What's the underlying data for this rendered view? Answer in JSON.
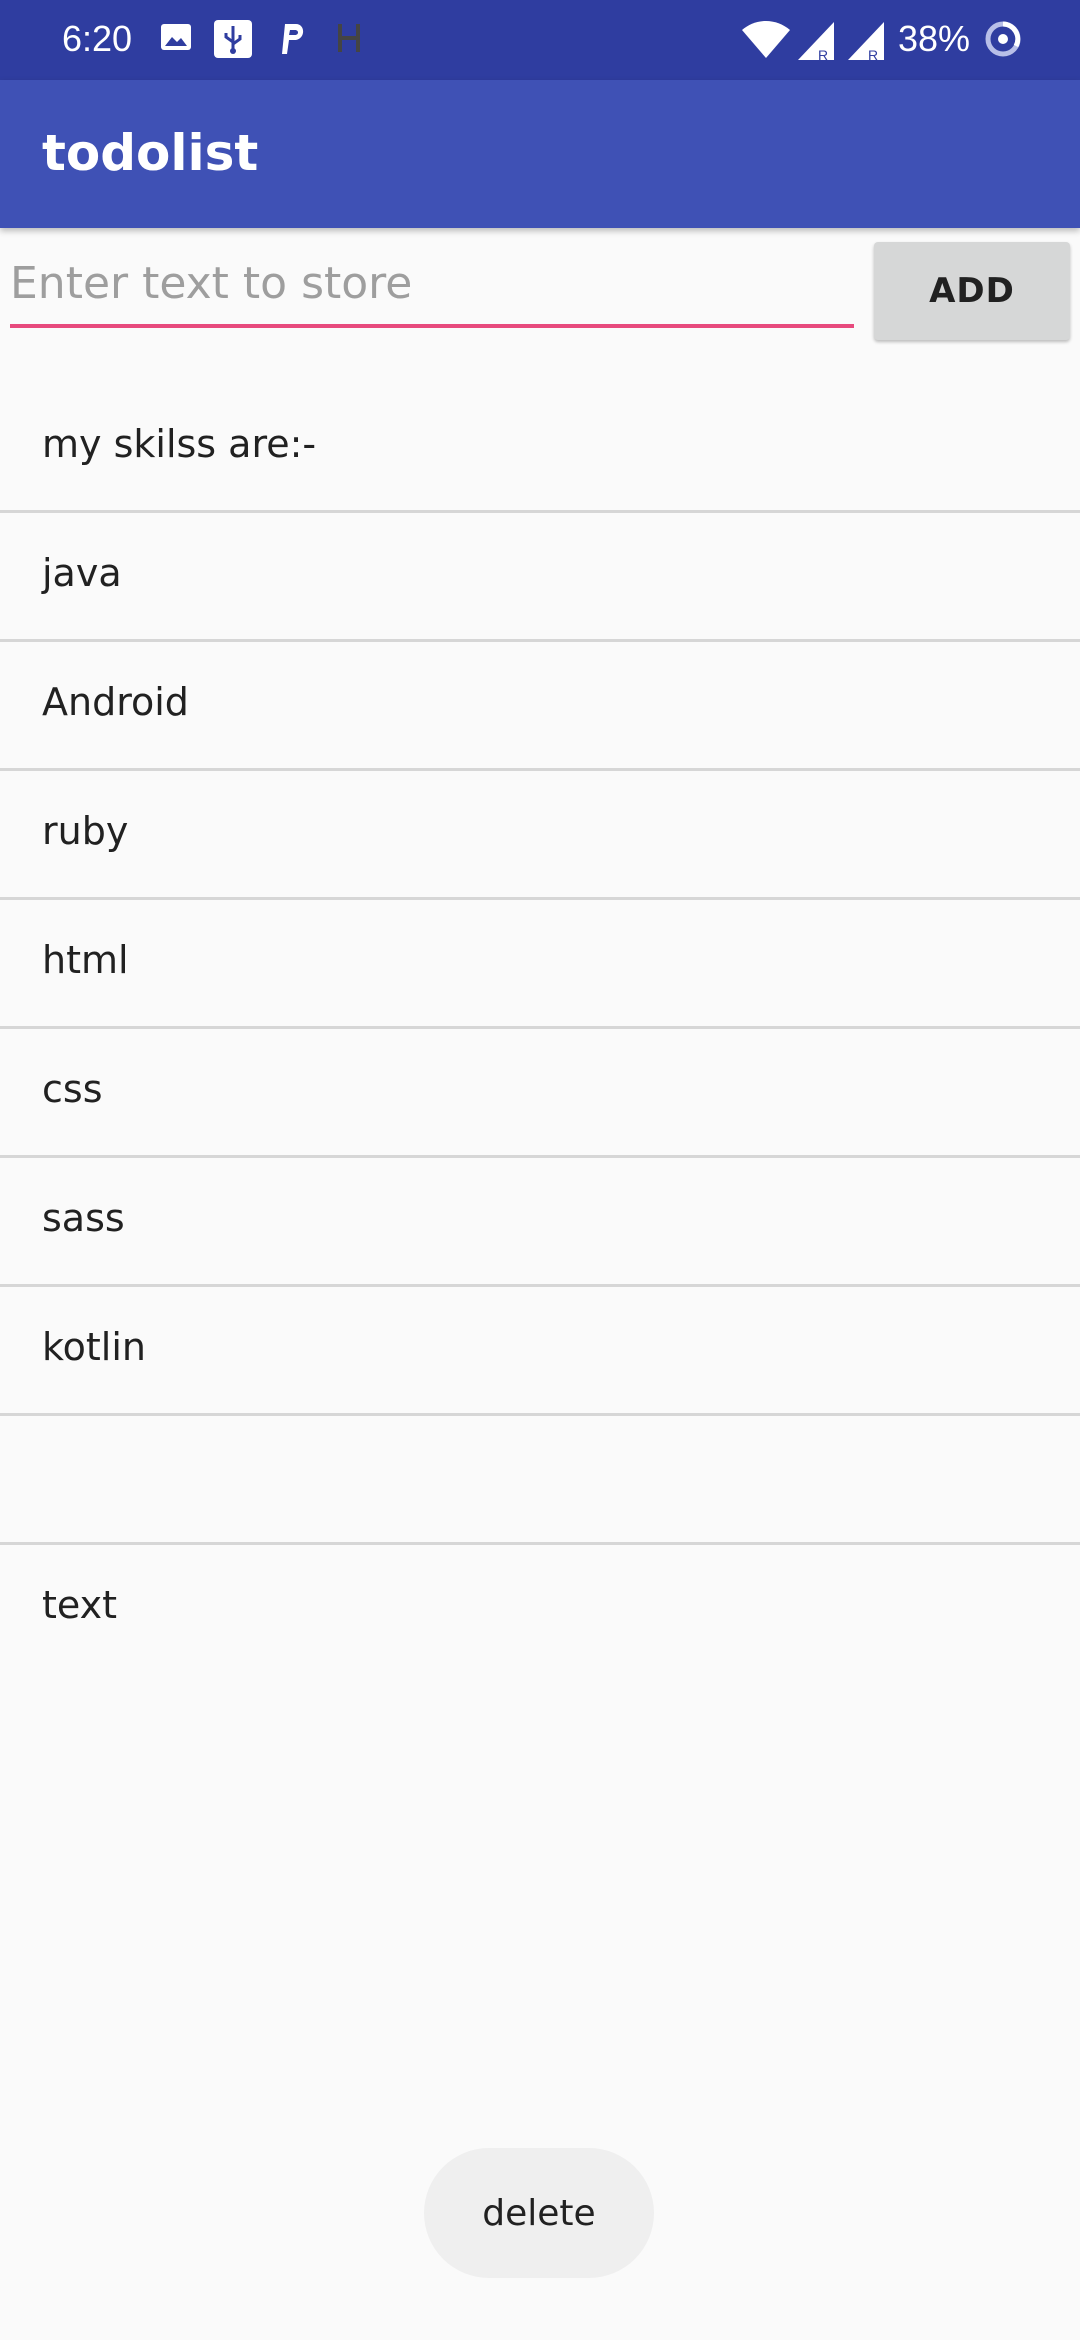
{
  "status_bar": {
    "time": "6:20",
    "battery": "38%",
    "icons": [
      "gallery-icon",
      "usb-icon",
      "parking-icon",
      "notification-icon",
      "wifi-icon",
      "signal-icon",
      "signal-icon",
      "battery-saver-icon"
    ]
  },
  "app_bar": {
    "title": "todolist"
  },
  "input": {
    "placeholder": "Enter text to store",
    "value": ""
  },
  "add_button": {
    "label": "ADD"
  },
  "list": {
    "items": [
      "my skilss are:-",
      "java",
      "Android",
      "ruby",
      "html",
      "css",
      "sass",
      "kotlin",
      "",
      "text"
    ]
  },
  "delete_button": {
    "label": "delete"
  },
  "colors": {
    "status_bar": "#2f3da0",
    "app_bar": "#3f51b5",
    "accent_underline": "#e74a7d",
    "add_button_bg": "#d6d7d7",
    "background": "#fafafa"
  }
}
